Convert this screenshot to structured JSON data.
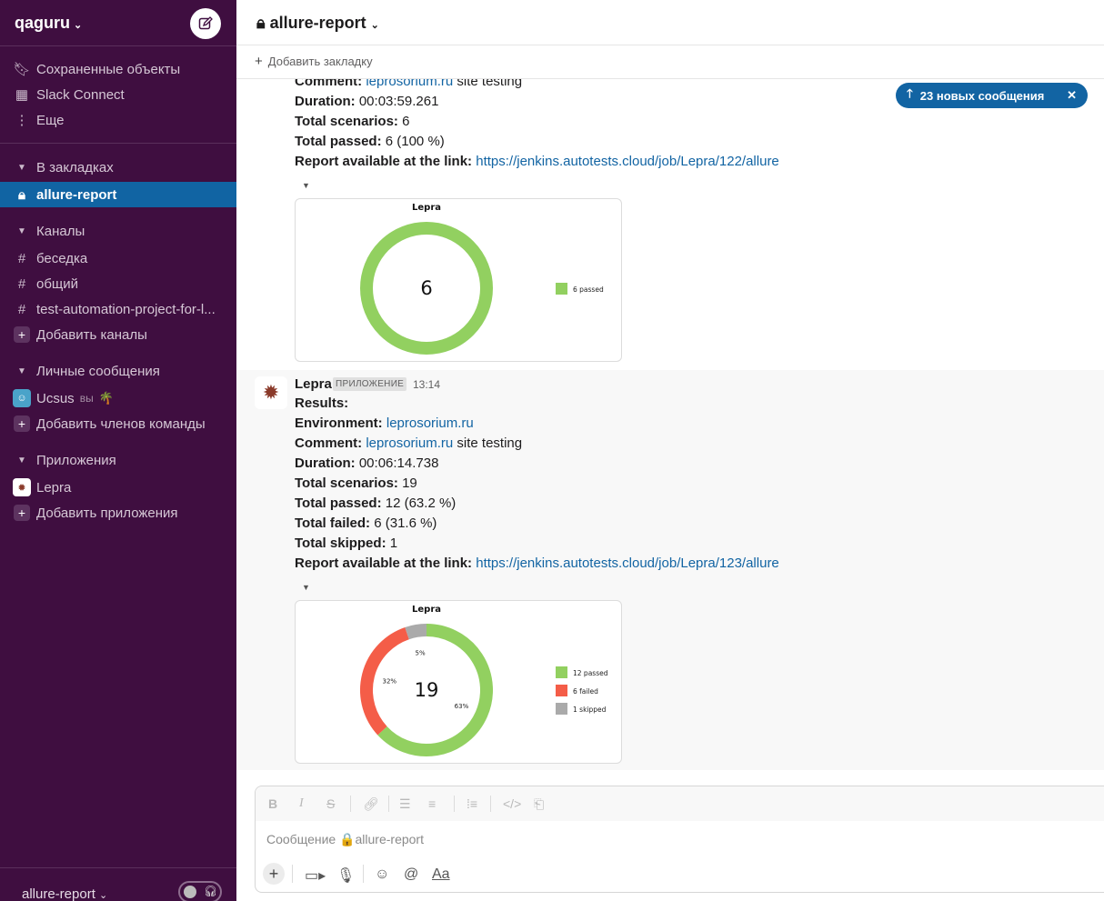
{
  "workspace": {
    "name": "qaguru"
  },
  "sidebar": {
    "top_items": [
      {
        "label": "Сохраненные объекты",
        "icon": "bookmark-icon"
      },
      {
        "label": "Slack Connect",
        "icon": "building-icon"
      },
      {
        "label": "Еще",
        "icon": "more-vertical-icon"
      }
    ],
    "bookmarks_section": "В закладках",
    "active_channel": "allure-report",
    "channels_section": "Каналы",
    "channels": [
      "беседка",
      "общий",
      "test-automation-project-for-l..."
    ],
    "add_channels": "Добавить каналы",
    "dm_section": "Личные сообщения",
    "dm_user": "Ucsus",
    "dm_you": "вы",
    "dm_status_emoji": "🌴",
    "add_members": "Добавить членов команды",
    "apps_section": "Приложения",
    "app_name": "Lepra",
    "add_apps": "Добавить приложения",
    "footer_channel": "allure-report"
  },
  "header": {
    "channel_title": "allure-report",
    "add_bookmark": "Добавить закладку"
  },
  "toast": {
    "label": "23 новых сообщения"
  },
  "messages": [
    {
      "comment_label": "Comment:",
      "comment_link": "leprosorium.ru",
      "comment_rest": " site testing",
      "duration_label": "Duration:",
      "duration": " 00:03:59.261",
      "scenarios_label": "Total scenarios:",
      "scenarios": " 6",
      "passed_label": "Total passed:",
      "passed": " 6 (100 %)",
      "report_label": "Report available at the link:",
      "report_link": "https://jenkins.autotests.cloud/job/Lepra/122/allure",
      "chart_title": "Lepra",
      "chart_center": "6",
      "legend": [
        "6 passed"
      ]
    },
    {
      "sender": "Lepra",
      "badge": "ПРИЛОЖЕНИЕ",
      "time": "13:14",
      "results": "Results:",
      "env_label": "Environment:",
      "env_link": "leprosorium.ru",
      "comment_label": "Comment:",
      "comment_link": "leprosorium.ru",
      "comment_rest": " site testing",
      "duration_label": "Duration:",
      "duration": " 00:06:14.738",
      "scenarios_label": "Total scenarios:",
      "scenarios": " 19",
      "passed_label": "Total passed:",
      "passed": " 12 (63.2 %)",
      "failed_label": "Total failed:",
      "failed": " 6 (31.6 %)",
      "skipped_label": "Total skipped:",
      "skipped": " 1",
      "report_label": "Report available at the link:",
      "report_link": "https://jenkins.autotests.cloud/job/Lepra/123/allure",
      "chart_title": "Lepra",
      "chart_center": "19",
      "legend": [
        "12 passed",
        "6 failed",
        "1 skipped"
      ],
      "pct_labels": [
        "63%",
        "32%",
        "5%"
      ]
    }
  ],
  "chart_data": [
    {
      "type": "pie",
      "title": "Lepra",
      "categories": [
        "passed"
      ],
      "values": [
        6
      ],
      "colors": [
        "#92d060"
      ]
    },
    {
      "type": "pie",
      "title": "Lepra",
      "categories": [
        "passed",
        "failed",
        "skipped"
      ],
      "values": [
        12,
        6,
        1
      ],
      "colors": [
        "#92d060",
        "#f45d48",
        "#aaaaaa"
      ]
    }
  ],
  "composer": {
    "placeholder": "Сообщение 🔒allure-report",
    "format_icons": [
      "bold-icon",
      "italic-icon",
      "strikethrough-icon",
      "link-icon",
      "ordered-list-icon",
      "bullet-list-icon",
      "blockquote-icon",
      "code-icon",
      "code-block-icon"
    ],
    "text_format": "Aa"
  }
}
